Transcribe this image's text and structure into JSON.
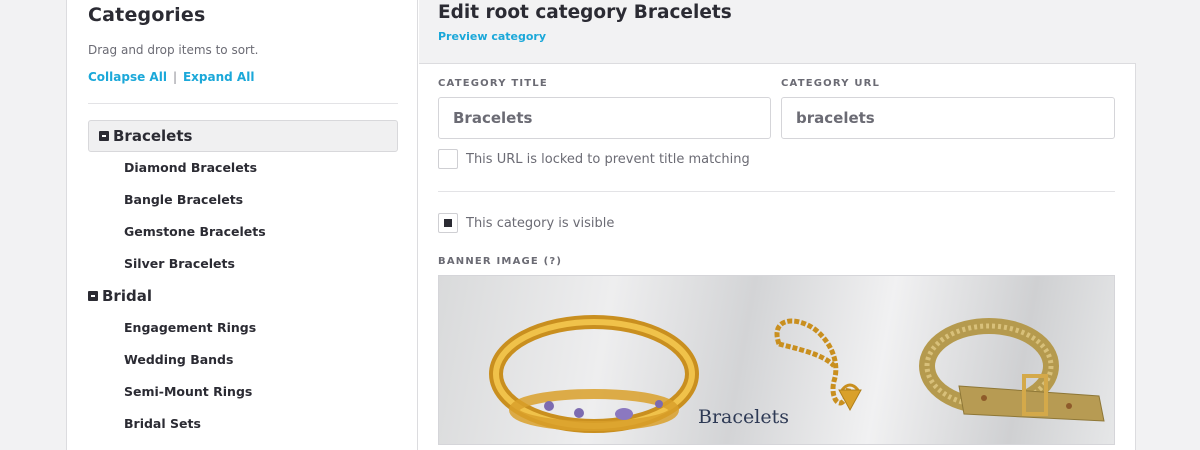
{
  "sidebar": {
    "title": "Categories",
    "hint": "Drag and drop items to sort.",
    "collapse_all": "Collapse All",
    "separator": "|",
    "expand_all": "Expand All",
    "categories": [
      {
        "label": "Bracelets",
        "children": [
          "Diamond Bracelets",
          "Bangle Bracelets",
          "Gemstone Bracelets",
          "Silver Bracelets"
        ]
      },
      {
        "label": "Bridal",
        "children": [
          "Engagement Rings",
          "Wedding Bands",
          "Semi-Mount Rings",
          "Bridal Sets"
        ]
      }
    ]
  },
  "main": {
    "title": "Edit root category Bracelets",
    "preview_link": "Preview category",
    "title_label": "CATEGORY TITLE",
    "title_value": "Bracelets",
    "url_label": "CATEGORY URL",
    "url_value": "bracelets",
    "url_lock_label": "This URL is locked to prevent title matching",
    "url_lock_checked": false,
    "visible_label": "This category is visible",
    "visible_checked": true,
    "banner_label": "BANNER IMAGE (?)",
    "banner_caption": "Bracelets"
  },
  "colors": {
    "accent": "#1ba8d9",
    "text": "#2b2b33",
    "header_bg": "#f2f2f3",
    "gold": "#d9a02a"
  }
}
